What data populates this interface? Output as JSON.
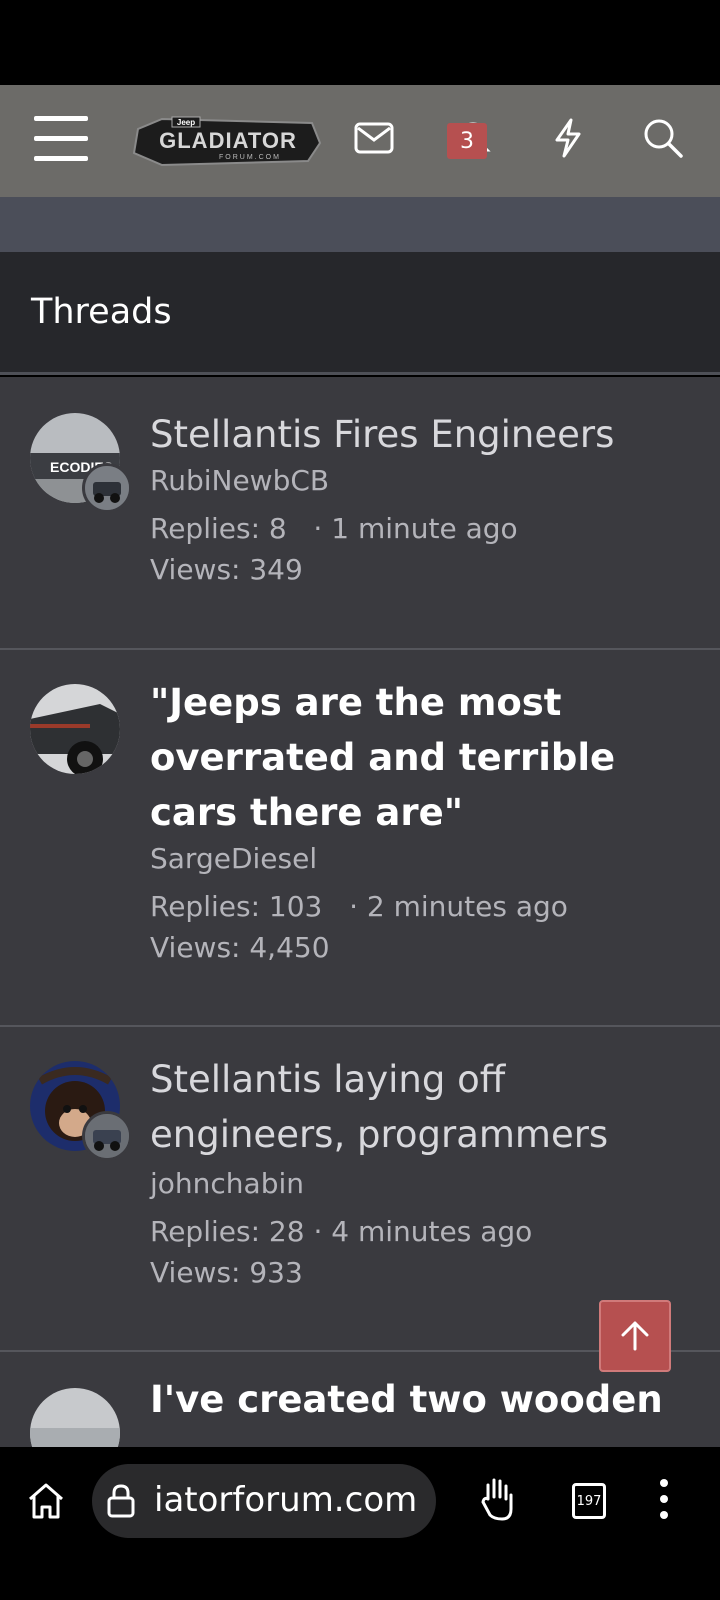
{
  "browser": {
    "url": "iatorforum.com",
    "tab_count": "197"
  },
  "header": {
    "logo_text": "GLADIATOR",
    "logo_sub": "FORUM.COM",
    "logo_badge": "Jeep",
    "alerts_count": "3",
    "icons": [
      "menu-icon",
      "envelope-icon",
      "bell-icon",
      "bolt-icon",
      "search-icon"
    ]
  },
  "section": {
    "title": "Threads"
  },
  "threads": [
    {
      "title": "Stellantis Fires Engineers",
      "author": "RubiNewbCB",
      "replies": "Replies: 8",
      "time": "· 1 minute ago",
      "views": "Views: 349",
      "bold": false
    },
    {
      "title": "\"Jeeps are the most overrated and terrible cars there are\"",
      "author": "SargeDiesel",
      "replies": "Replies: 103",
      "time": "· 2 minutes ago",
      "views": "Views: 4,450",
      "bold": true
    },
    {
      "title": "Stellantis laying off engineers, programmers",
      "author": "johnchabin",
      "replies": "Replies: 28",
      "time": "· 4 minutes ago",
      "views": "Views: 933",
      "bold": false
    },
    {
      "title": "I've created two wooden",
      "bold": true
    }
  ],
  "colors": {
    "nav_bg": "#6c6b68",
    "list_bg": "#3a3a3f",
    "accent": "#b65050"
  }
}
